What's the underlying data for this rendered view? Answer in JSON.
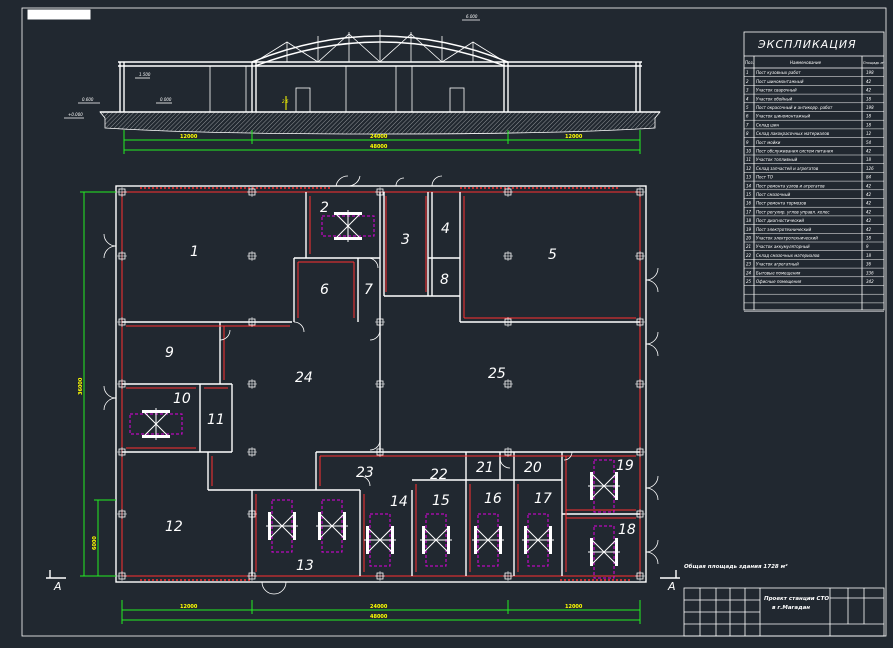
{
  "sheet": {
    "stamp": "",
    "area_note": "Общая площадь здания 1728 м²",
    "title_line1": "Проект станции СТО",
    "title_line2": "в г.Магадан",
    "sheet_code": "",
    "section_mark": "А"
  },
  "elevation": {
    "top_mark": "6.000",
    "mark_1": "1.500",
    "mark_2": "0.600",
    "mark_3": "0.000",
    "mark_4": "+0.000",
    "ramp_mark": "2.6",
    "dim_left": "12000",
    "dim_mid": "24000",
    "dim_right": "12000",
    "dim_total": "48000"
  },
  "plan_dims": {
    "left_vertical": "36000",
    "left_lower": "6000",
    "bottom_left": "12000",
    "bottom_mid": "24000",
    "bottom_right": "12000",
    "bottom_total": "48000"
  },
  "rooms": [
    {
      "id": "1",
      "label": "1"
    },
    {
      "id": "2",
      "label": "2"
    },
    {
      "id": "3",
      "label": "3"
    },
    {
      "id": "4",
      "label": "4"
    },
    {
      "id": "5",
      "label": "5"
    },
    {
      "id": "6",
      "label": "6"
    },
    {
      "id": "7",
      "label": "7"
    },
    {
      "id": "8",
      "label": "8"
    },
    {
      "id": "9",
      "label": "9"
    },
    {
      "id": "10",
      "label": "10"
    },
    {
      "id": "11",
      "label": "11"
    },
    {
      "id": "12",
      "label": "12"
    },
    {
      "id": "13",
      "label": "13"
    },
    {
      "id": "14",
      "label": "14"
    },
    {
      "id": "15",
      "label": "15"
    },
    {
      "id": "16",
      "label": "16"
    },
    {
      "id": "17",
      "label": "17"
    },
    {
      "id": "18",
      "label": "18"
    },
    {
      "id": "19",
      "label": "19"
    },
    {
      "id": "20",
      "label": "20"
    },
    {
      "id": "21",
      "label": "21"
    },
    {
      "id": "22",
      "label": "22"
    },
    {
      "id": "23",
      "label": "23"
    },
    {
      "id": "24",
      "label": "24"
    },
    {
      "id": "25",
      "label": "25"
    }
  ],
  "explication": {
    "title": "ЭКСПЛИКАЦИЯ",
    "col_no": "Поз.",
    "col_name": "Наименование",
    "col_area": "Площадь м²",
    "rows": [
      {
        "no": "1",
        "name": "Пост кузовных работ",
        "area": "198"
      },
      {
        "no": "2",
        "name": "Пост шиномонтажный",
        "area": "42"
      },
      {
        "no": "3",
        "name": "Участок сварочный",
        "area": "42"
      },
      {
        "no": "4",
        "name": "Участок обойный",
        "area": "18"
      },
      {
        "no": "5",
        "name": "Пост окрасочный и антикорр. работ",
        "area": "198"
      },
      {
        "no": "6",
        "name": "Участок шиномонтажный",
        "area": "18"
      },
      {
        "no": "7",
        "name": "Склад шин",
        "area": "18"
      },
      {
        "no": "8",
        "name": "Склад лакокрасочных материалов",
        "area": "12"
      },
      {
        "no": "9",
        "name": "Пост мойки",
        "area": "54"
      },
      {
        "no": "10",
        "name": "Пост обслуживания систем питания",
        "area": "42"
      },
      {
        "no": "11",
        "name": "Участок топливный",
        "area": "18"
      },
      {
        "no": "12",
        "name": "Склад запчастей и агрегатов",
        "area": "126"
      },
      {
        "no": "13",
        "name": "Пост ТО",
        "area": "84"
      },
      {
        "no": "14",
        "name": "Пост ремонта узлов и агрегатов",
        "area": "42"
      },
      {
        "no": "15",
        "name": "Пост смазочный",
        "area": "42"
      },
      {
        "no": "16",
        "name": "Пост ремонта тормозов",
        "area": "42"
      },
      {
        "no": "17",
        "name": "Пост регулир. углов управл. колес",
        "area": "42"
      },
      {
        "no": "18",
        "name": "Пост диагностический",
        "area": "42"
      },
      {
        "no": "19",
        "name": "Пост электротехнический",
        "area": "42"
      },
      {
        "no": "20",
        "name": "Участок электротехнический",
        "area": "18"
      },
      {
        "no": "21",
        "name": "Участок аккумуляторный",
        "area": "9"
      },
      {
        "no": "22",
        "name": "Склад смазочных материалов",
        "area": "18"
      },
      {
        "no": "23",
        "name": "Участок агрегатный",
        "area": "36"
      },
      {
        "no": "24",
        "name": "Бытовые помещения",
        "area": "336"
      },
      {
        "no": "25",
        "name": "Офисные помещения",
        "area": "342"
      },
      {
        "no": "",
        "name": "",
        "area": ""
      },
      {
        "no": "",
        "name": "",
        "area": ""
      },
      {
        "no": "",
        "name": "",
        "area": ""
      }
    ]
  }
}
